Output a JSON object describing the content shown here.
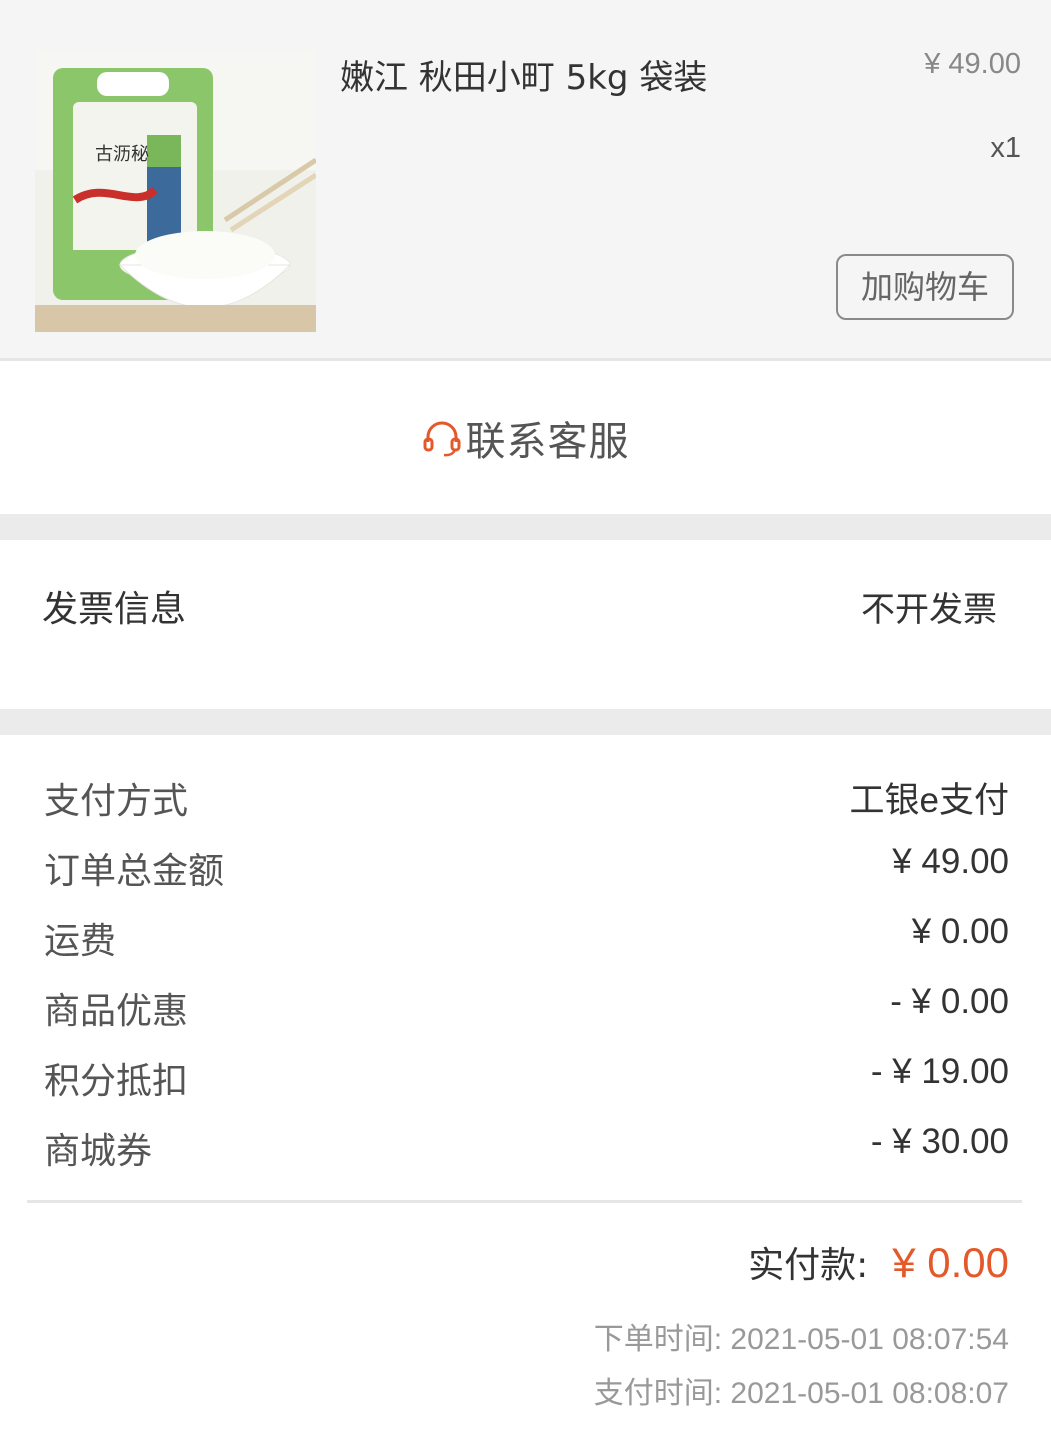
{
  "product": {
    "name": "嫩江 秋田小町 5kg 袋装",
    "price": "¥ 49.00",
    "quantity": "x1",
    "add_to_cart_label": "加购物车",
    "image_text": "古沥秘"
  },
  "contact": {
    "label": "联系客服",
    "icon": "headset-icon",
    "icon_color": "#e4582a"
  },
  "invoice": {
    "label": "发票信息",
    "value": "不开发票"
  },
  "payment": {
    "rows": [
      {
        "label": "支付方式",
        "value": "工银e支付"
      },
      {
        "label": "订单总金额",
        "value": "¥ 49.00"
      },
      {
        "label": "运费",
        "value": "¥ 0.00"
      },
      {
        "label": "商品优惠",
        "value": "- ¥ 0.00"
      },
      {
        "label": "积分抵扣",
        "value": "- ¥ 19.00"
      },
      {
        "label": "商城券",
        "value": "- ¥ 30.00"
      }
    ],
    "paid_label": "实付款:",
    "paid_value": "¥ 0.00",
    "accent_color": "#e4582a"
  },
  "times": {
    "order_label": "下单时间:",
    "order_time": "2021-05-01 08:07:54",
    "pay_label": "支付时间:",
    "pay_time": "2021-05-01 08:08:07"
  }
}
